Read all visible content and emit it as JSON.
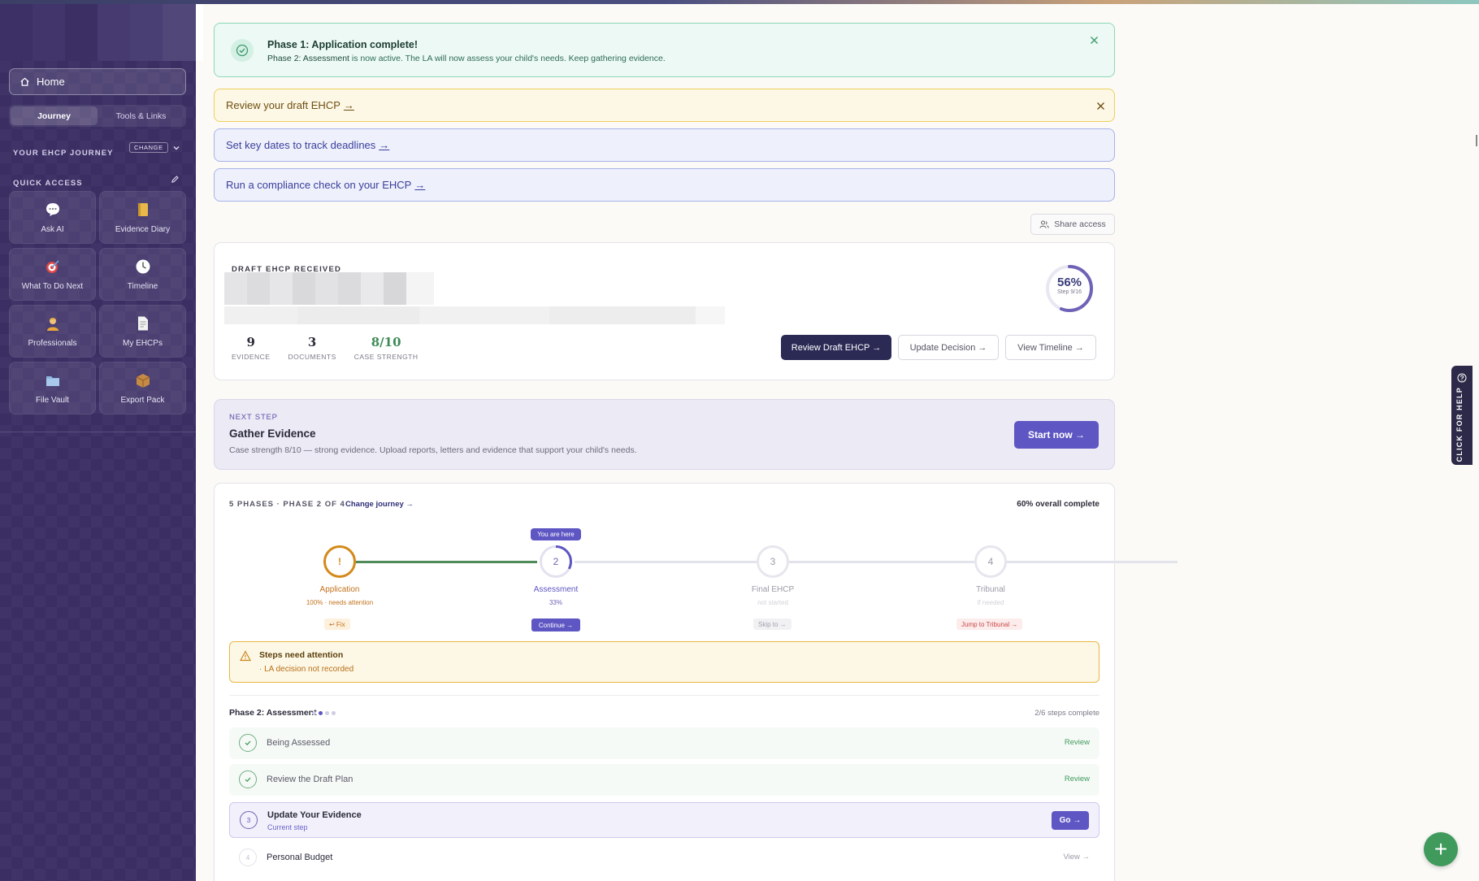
{
  "sidebar": {
    "home_label": "Home",
    "tabs": [
      {
        "label": "Journey"
      },
      {
        "label": "Tools & Links"
      }
    ],
    "journey_label": "YOUR EHCP JOURNEY",
    "change_label": "CHANGE",
    "quick_access_label": "QUICK ACCESS",
    "quick_access": [
      {
        "label": "Ask AI",
        "icon": "speech-bubble-icon"
      },
      {
        "label": "Evidence Diary",
        "icon": "notebook-icon"
      },
      {
        "label": "What To Do Next",
        "icon": "target-icon"
      },
      {
        "label": "Timeline",
        "icon": "clock-icon"
      },
      {
        "label": "Professionals",
        "icon": "professional-icon"
      },
      {
        "label": "My EHCPs",
        "icon": "document-icon"
      },
      {
        "label": "File Vault",
        "icon": "folder-icon"
      },
      {
        "label": "Export Pack",
        "icon": "package-icon"
      }
    ]
  },
  "banners": {
    "success_title": "Phase 1: Application complete!",
    "success_bold": "Phase 2: Assessment",
    "success_text": " is now active. The LA will now assess your child's needs. Keep gathering evidence.",
    "review_draft": "Review your draft EHCP",
    "key_dates": "Set key dates to track deadlines",
    "compliance": "Run a compliance check on your EHCP",
    "arrow": "→"
  },
  "share_label": "Share access",
  "draft": {
    "title": "DRAFT EHCP RECEIVED",
    "stats": [
      {
        "value": "9",
        "label": "EVIDENCE"
      },
      {
        "value": "3",
        "label": "DOCUMENTS"
      },
      {
        "value": "8/10",
        "label": "CASE STRENGTH"
      }
    ],
    "progress_pct": "56%",
    "progress_value": 0.56,
    "progress_step": "Step 9/16",
    "btn_review": "Review Draft EHCP →",
    "btn_update": "Update Decision →",
    "btn_timeline": "View Timeline →"
  },
  "next_step": {
    "label": "NEXT STEP",
    "title": "Gather Evidence",
    "desc": "Case strength 8/10 — strong evidence. Upload reports, letters and evidence that support your child's needs.",
    "button": "Start now →"
  },
  "journey": {
    "header": "5 PHASES · PHASE 2 OF 4",
    "change": "Change journey →",
    "overall": "60% overall complete",
    "you_are_here": "You are here",
    "assessment_progress": 0.33,
    "phases": [
      {
        "num": "!",
        "label": "Application",
        "sub": "100% · needs attention",
        "action": "↩ Fix"
      },
      {
        "num": "2",
        "label": "Assessment",
        "sub": "33%",
        "action": "Continue →"
      },
      {
        "num": "3",
        "label": "Final EHCP",
        "sub": "not started",
        "action": "Skip to →"
      },
      {
        "num": "4",
        "label": "Tribunal",
        "sub": "if needed",
        "action": "Jump to Tribunal →"
      }
    ],
    "attention_title": "Steps need attention",
    "attention_item": "· LA decision not recorded",
    "phase_title": "Phase 2: Assessment",
    "phase_count": "2/6 steps complete",
    "steps": [
      {
        "title": "Being Assessed",
        "action": "Review"
      },
      {
        "title": "Review the Draft Plan",
        "action": "Review"
      },
      {
        "num": "3",
        "title": "Update Your Evidence",
        "sub": "Current step",
        "action": "Go →"
      },
      {
        "num": "4",
        "title": "Personal Budget",
        "action": "View →"
      }
    ]
  },
  "help_label": "CLICK FOR HELP",
  "fab_label": "+",
  "colors": {
    "sidebar": "#3a2e63",
    "accent": "#5e56c3",
    "success": "#3f9a5c",
    "warning": "#d38a1a"
  }
}
